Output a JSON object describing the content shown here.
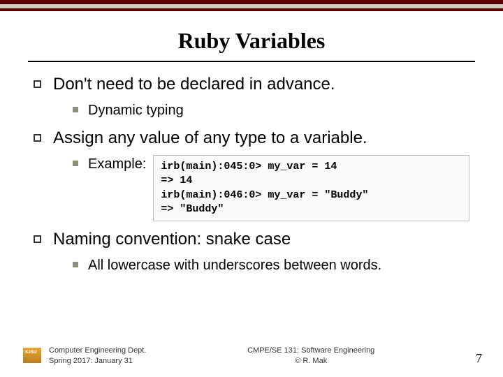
{
  "title": "Ruby Variables",
  "bullets": {
    "b1": {
      "text": "Don't need to be declared in advance.",
      "sub": {
        "s1": "Dynamic typing"
      }
    },
    "b2": {
      "text": "Assign any value of any type to a variable.",
      "sub": {
        "label": "Example:"
      }
    },
    "b3": {
      "text": "Naming convention: snake case",
      "sub": {
        "s1": "All lowercase with underscores between words."
      }
    }
  },
  "code": {
    "l1": "irb(main):045:0> my_var = 14",
    "l2": "=> 14",
    "l3": "irb(main):046:0> my_var = \"Buddy\"",
    "l4": "=> \"Buddy\""
  },
  "footer": {
    "dept_l1": "Computer Engineering Dept.",
    "dept_l2": "Spring 2017: January 31",
    "course_l1": "CMPE/SE 131: Software Engineering",
    "course_l2": "© R. Mak",
    "logo": "SJSU"
  },
  "page_number": "7"
}
